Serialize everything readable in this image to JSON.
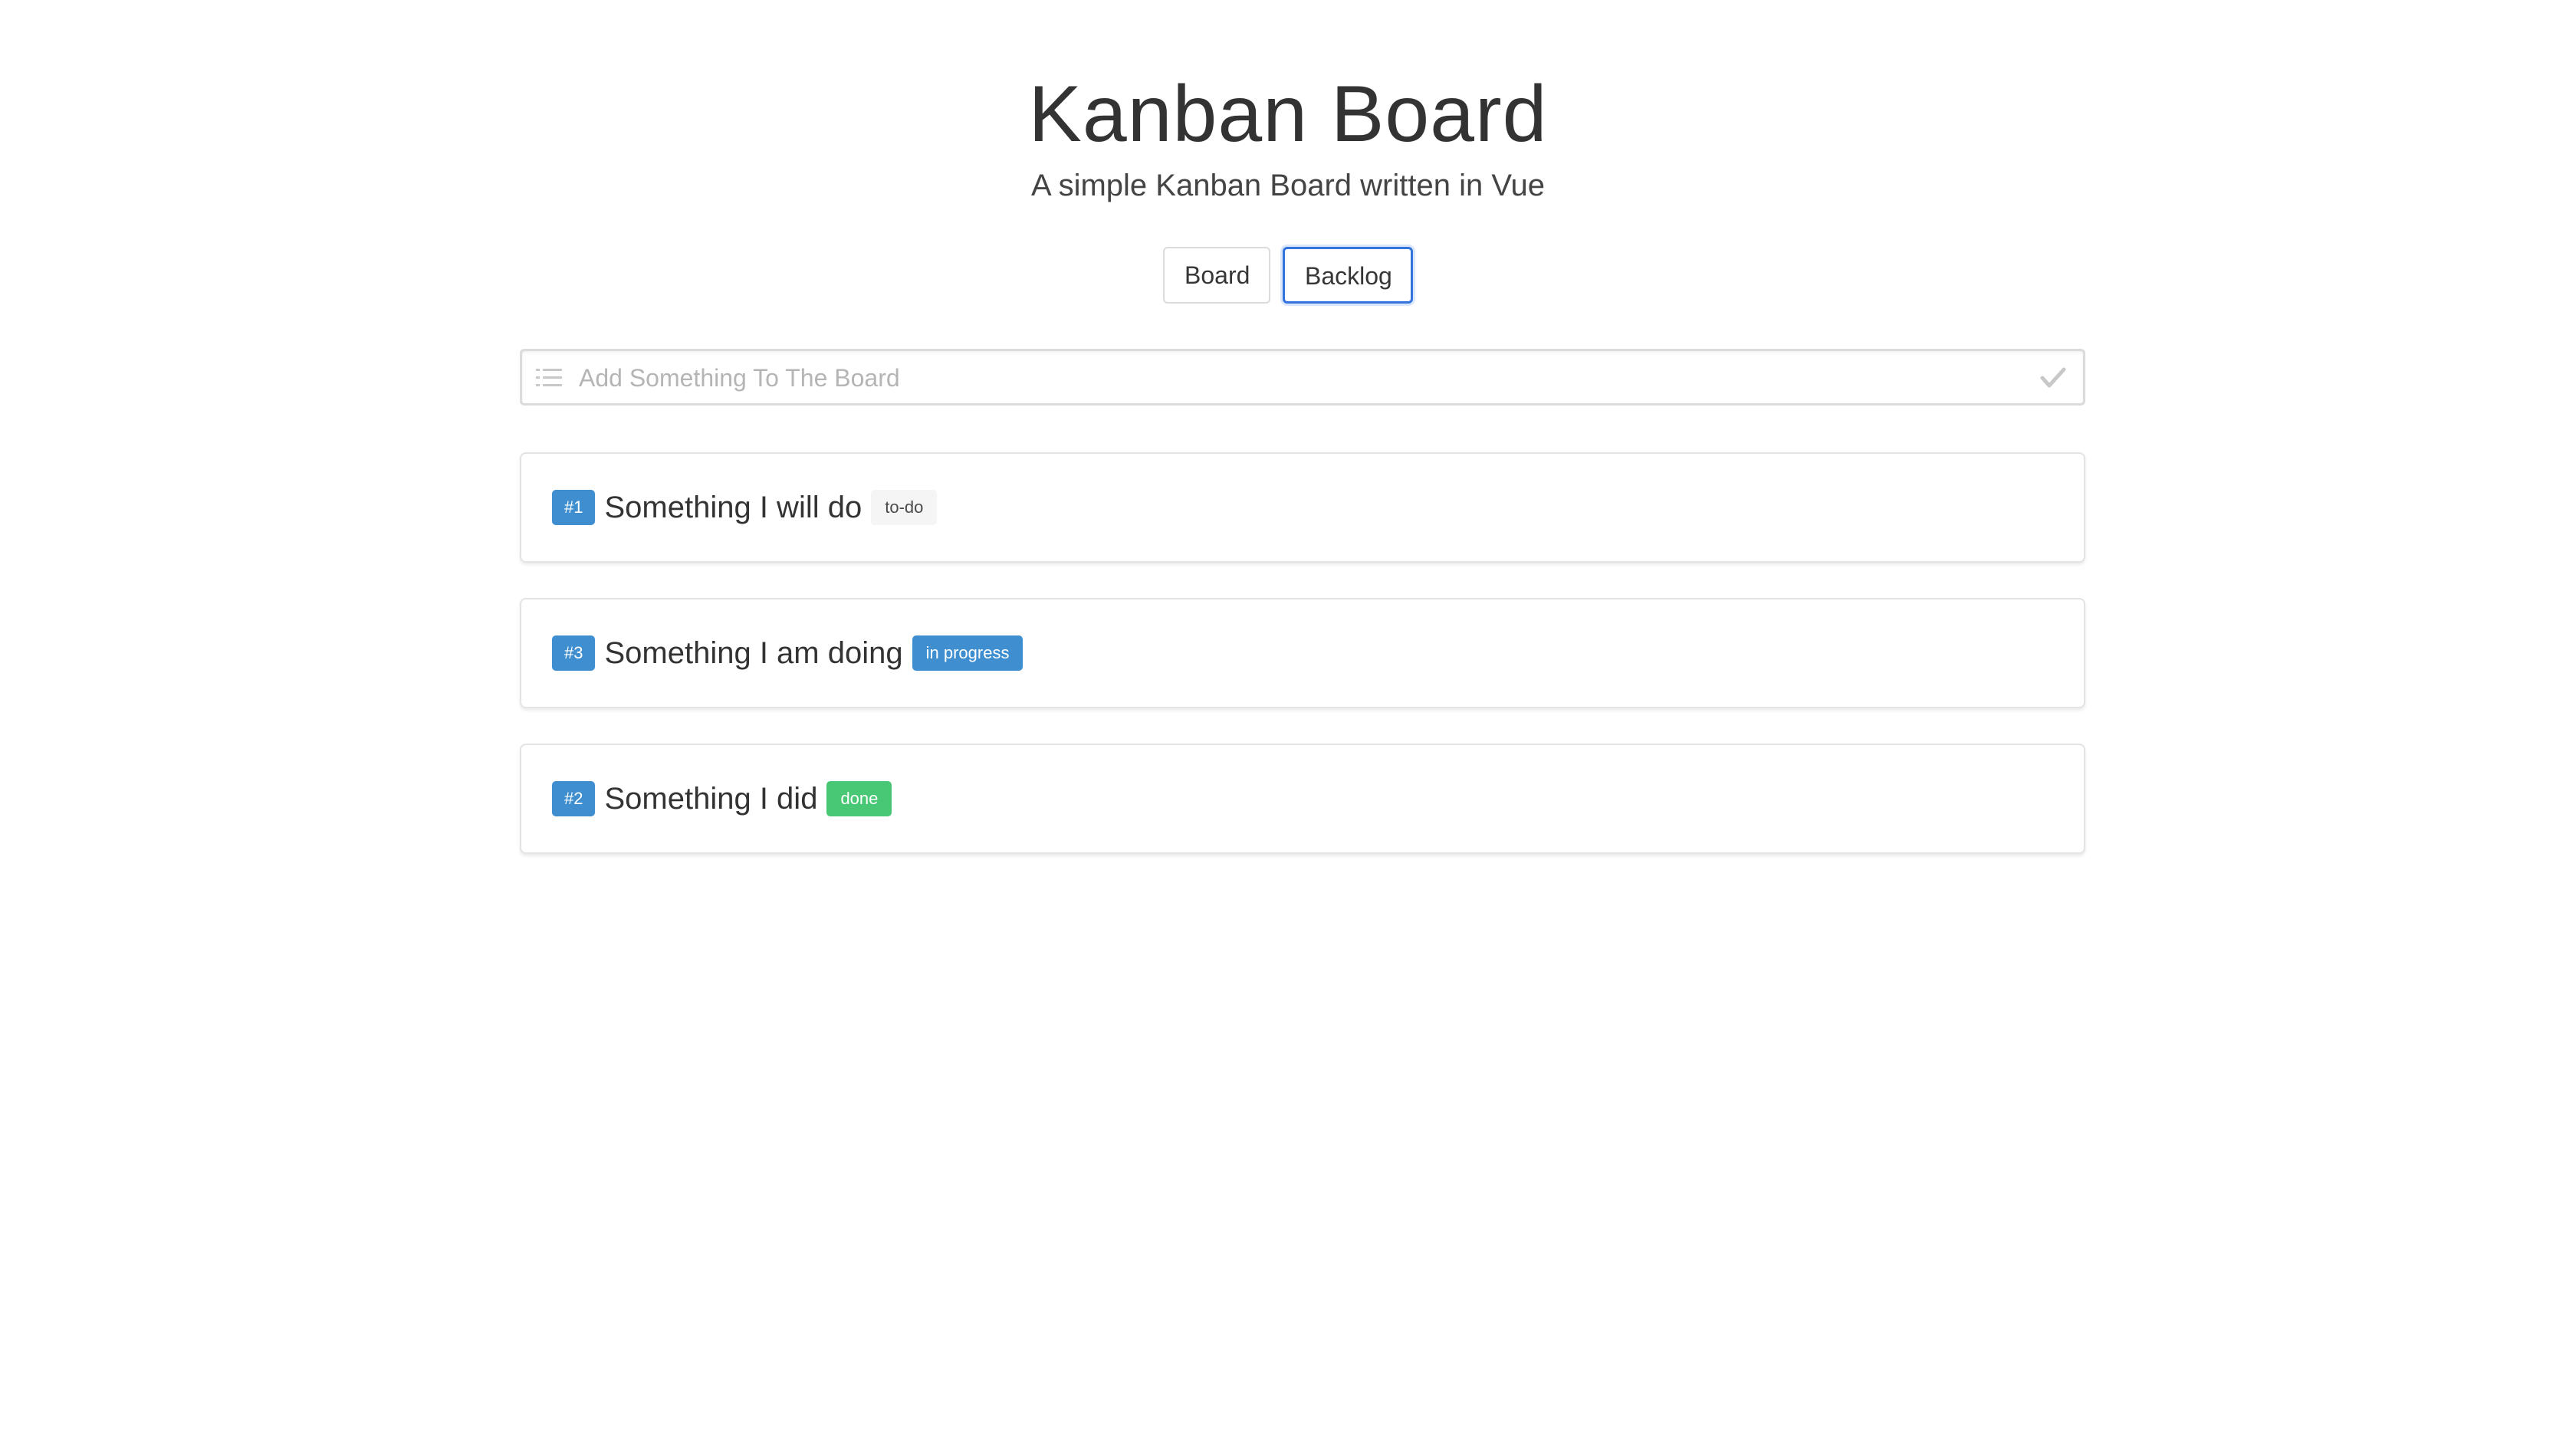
{
  "header": {
    "title": "Kanban Board",
    "subtitle": "A simple Kanban Board written in Vue"
  },
  "nav": {
    "board_label": "Board",
    "backlog_label": "Backlog",
    "active": "Backlog"
  },
  "add_input": {
    "placeholder": "Add Something To The Board",
    "value": "",
    "left_icon": "list-icon",
    "right_icon": "check-icon"
  },
  "items": [
    {
      "id": "#1",
      "title": "Something I will do",
      "status": "to-do"
    },
    {
      "id": "#3",
      "title": "Something I am doing",
      "status": "in progress"
    },
    {
      "id": "#2",
      "title": "Something I did",
      "status": "done"
    }
  ],
  "colors": {
    "id_tag": "#3e8ed0",
    "todo_tag": "#f5f5f5",
    "in_progress_tag": "#3e8ed0",
    "done_tag": "#48c774",
    "active_border": "#3273dc"
  }
}
